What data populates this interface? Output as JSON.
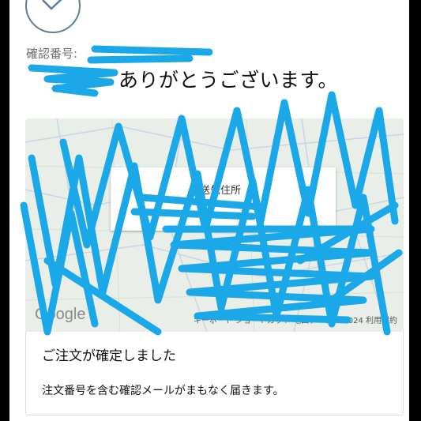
{
  "confirmation": {
    "label": "確認番号:",
    "thanks": "ありがとうございます。"
  },
  "map": {
    "popup_label": "配送先住所",
    "attribution": "キーボード ショートカット   地図データ ©2024   利用規約",
    "logo": "Google"
  },
  "order_card": {
    "title": "ご注文が確定しました",
    "body": "注文番号を含む確認メールがまもなく届きます。"
  },
  "colors": {
    "accent_circle": "#5f7d95",
    "redaction": "#1aa8e8"
  },
  "icons": [
    "checkmark-icon"
  ]
}
